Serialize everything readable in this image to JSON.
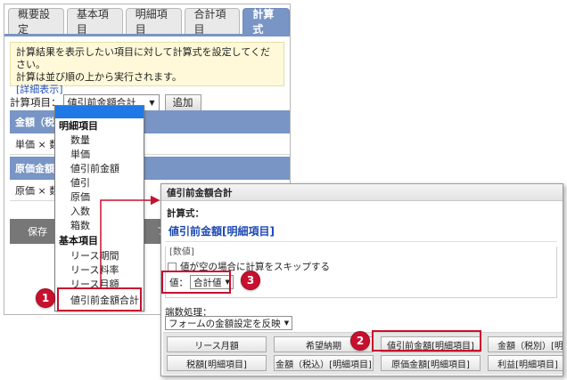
{
  "tabs": [
    {
      "label": "概要設定",
      "active": false
    },
    {
      "label": "基本項目",
      "active": false
    },
    {
      "label": "明細項目",
      "active": false
    },
    {
      "label": "合計項目",
      "active": false
    },
    {
      "label": "計算式",
      "active": true
    }
  ],
  "info": {
    "line1": "計算結果を表示したい項目に対して計算式を設定してください。",
    "line2": "計算は並び順の上から実行されます。",
    "link": "[詳細表示]"
  },
  "calc_row": {
    "label": "計算項目：",
    "selected": "値引前金額合計",
    "add_button": "追加"
  },
  "sections": [
    {
      "header": "金額（税",
      "body": "単価 × 数"
    },
    {
      "header": "原価金額",
      "body": "原価 × 数"
    }
  ],
  "save_button": "保存",
  "peek_char": "フ",
  "dropdown": {
    "groups": [
      {
        "label": "明細項目",
        "items": [
          "数量",
          "単価",
          "値引前金額",
          "値引",
          "原価",
          "入数",
          "箱数"
        ]
      },
      {
        "label": "基本項目",
        "items": [
          "リース期間",
          "リース料率",
          "リース月額",
          "値引前金額合計"
        ]
      }
    ]
  },
  "dialog": {
    "title": "値引前金額合計",
    "formula_label": "計算式：",
    "formula": "値引前金額[明細項目]",
    "partial_text": "[数値]",
    "skip_label": "値が空の場合に計算をスキップする",
    "value_label": "値：",
    "value_option": "合計値",
    "rounding_label": "端数処理：",
    "rounding_option": "フォームの金額設定を反映",
    "buttons_row1": [
      "リース月額",
      "希望納期",
      "値引前金額[明細項目]",
      "金額（税別）[明細項"
    ],
    "buttons_row2": [
      "税額[明細項目]",
      "金額（税込）[明細項目]",
      "原価金額[明細項目]",
      "利益[明細項目]"
    ]
  },
  "callouts": [
    "1",
    "2",
    "3"
  ],
  "colors": {
    "accent": "#7895c5",
    "callout": "#c8102e",
    "link": "#2553b8",
    "formula": "#1c49b3"
  }
}
